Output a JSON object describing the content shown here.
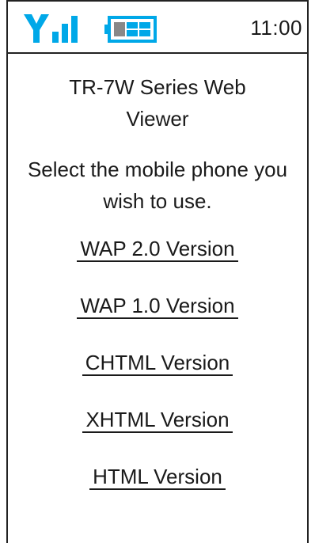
{
  "status_bar": {
    "signal_icon": "signal-strength-icon",
    "battery_icon": "battery-icon",
    "time": "11:00",
    "accent_color": "#00a8e8"
  },
  "page": {
    "title": "TR-7W Series Web Viewer",
    "instruction": "Select the mobile phone you wish to use."
  },
  "links": [
    {
      "label": "WAP 2.0 Version"
    },
    {
      "label": "WAP 1.0 Version"
    },
    {
      "label": "CHTML Version"
    },
    {
      "label": "XHTML Version"
    },
    {
      "label": "HTML Version"
    }
  ]
}
